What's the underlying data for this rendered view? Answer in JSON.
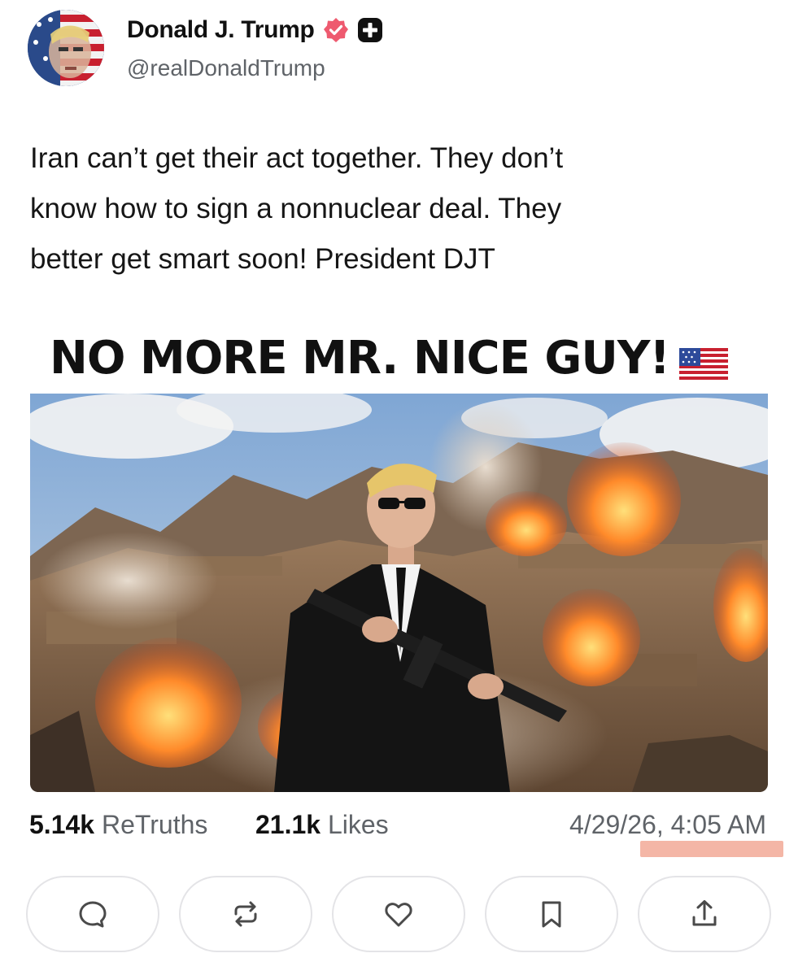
{
  "author": {
    "display_name": "Donald J. Trump",
    "handle": "@realDonaldTrump",
    "verified_icon": "verified-badge-icon",
    "badge_icon": "plus-badge-icon",
    "verified_color": "#ee5a6f"
  },
  "post": {
    "text": "Iran can’t get their act together. They don’t\nknow how to sign a nonnuclear deal. They\nbetter get smart soon! President DJT"
  },
  "media": {
    "headline": "NO MORE MR. NICE GUY!",
    "flag_icon": "us-flag-emoji-icon"
  },
  "stats": {
    "retruths_count": "5.14k",
    "retruths_label": "ReTruths",
    "likes_count": "21.1k",
    "likes_label": "Likes",
    "timestamp": "4/29/26, 4:05 AM"
  },
  "actions": [
    {
      "icon": "reply-icon"
    },
    {
      "icon": "retruth-icon"
    },
    {
      "icon": "like-icon"
    },
    {
      "icon": "bookmark-icon"
    },
    {
      "icon": "share-icon"
    }
  ],
  "colors": {
    "highlight": "#f4b6a6",
    "button_border": "#e4e4e7",
    "muted_text": "#5f6368"
  }
}
